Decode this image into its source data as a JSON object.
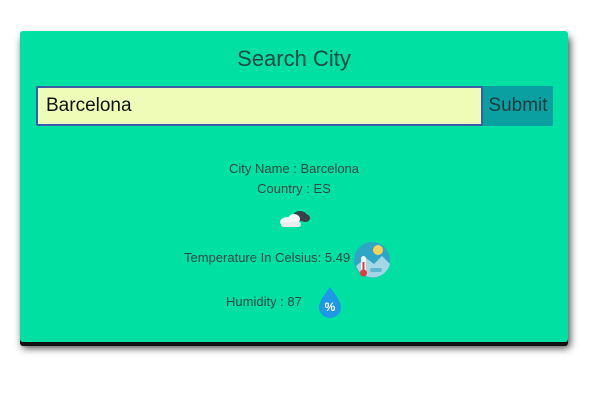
{
  "header": {
    "title": "Search City"
  },
  "search": {
    "value": "Barcelona",
    "submit_label": "Submit"
  },
  "result": {
    "city_line": "City Name : Barcelona",
    "country_line": "Country : ES",
    "weather_icon": "partly-cloudy-night-icon",
    "temperature_line": "Temperature In Celsius: 5.49",
    "temperature_icon": "thermometer-landscape-icon",
    "humidity_line": "Humidity : 87",
    "humidity_icon": "humidity-drop-icon"
  },
  "colors": {
    "card": "#00e0a3",
    "input_bg": "#eefcb8",
    "input_border": "#3a5da8",
    "button": "#0aa0a2"
  }
}
